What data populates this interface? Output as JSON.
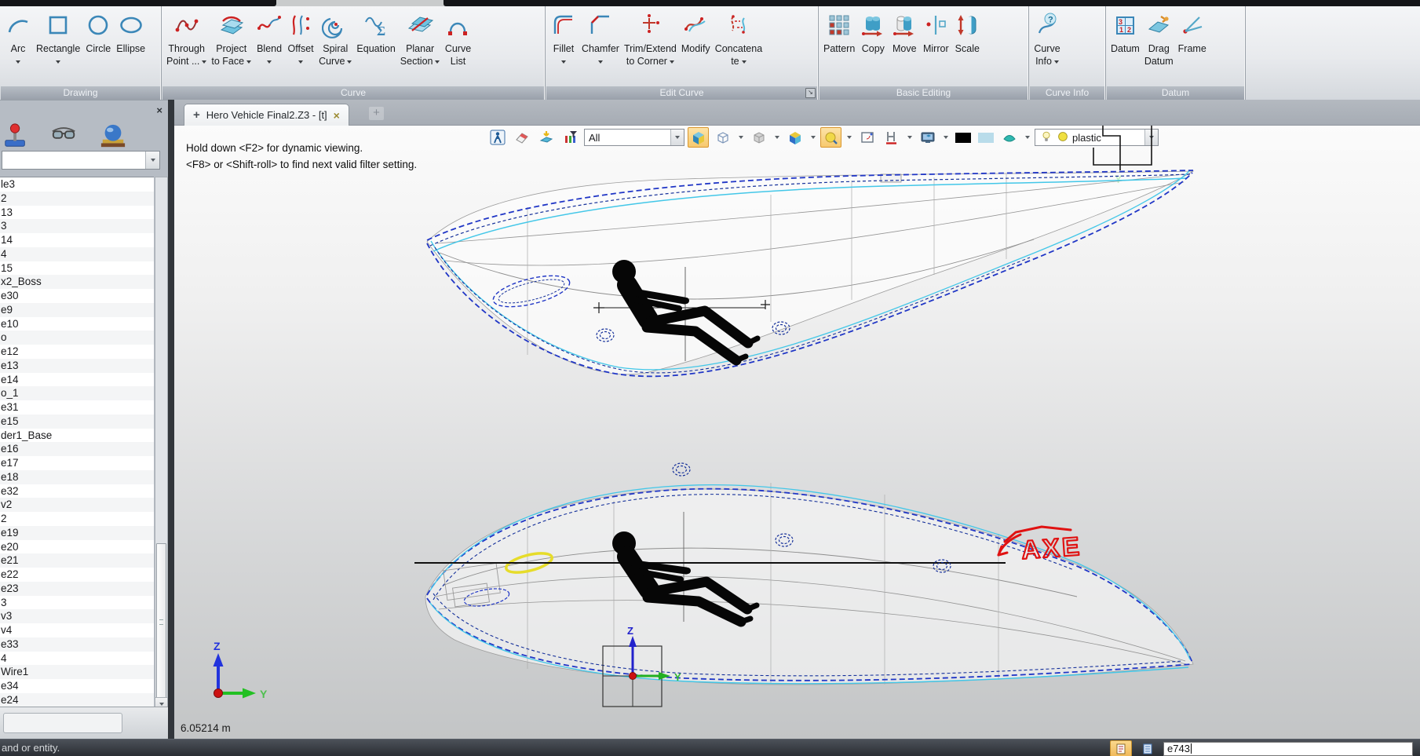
{
  "ribbon": {
    "groups": [
      {
        "label": "Drawing",
        "buttons": [
          {
            "icon": "arc",
            "line1": "Arc",
            "arrow": "below"
          },
          {
            "icon": "rectangle",
            "line1": "Rectangle",
            "arrow": "below"
          },
          {
            "icon": "circle",
            "line1": "Circle",
            "arrow": "none"
          },
          {
            "icon": "ellipse",
            "line1": "Ellipse",
            "arrow": "none"
          }
        ]
      },
      {
        "label": "Curve",
        "buttons": [
          {
            "icon": "through-point",
            "line1": "Through",
            "line2": "Point ...",
            "arrow": "inline"
          },
          {
            "icon": "project-to-face",
            "line1": "Project",
            "line2": "to Face",
            "arrow": "inline"
          },
          {
            "icon": "blend",
            "line1": "Blend",
            "arrow": "below"
          },
          {
            "icon": "offset",
            "line1": "Offset",
            "arrow": "below"
          },
          {
            "icon": "spiral-curve",
            "line1": "Spiral",
            "line2": "Curve",
            "arrow": "inline"
          },
          {
            "icon": "equation",
            "line1": "Equation",
            "arrow": "none"
          },
          {
            "icon": "planar-section",
            "line1": "Planar",
            "line2": "Section",
            "arrow": "inline"
          },
          {
            "icon": "curve-list",
            "line1": "Curve",
            "line2": "List",
            "arrow": "none"
          }
        ]
      },
      {
        "label": "Edit Curve",
        "dialog_launcher": true,
        "buttons": [
          {
            "icon": "fillet",
            "line1": "Fillet",
            "arrow": "below"
          },
          {
            "icon": "chamfer",
            "line1": "Chamfer",
            "arrow": "below"
          },
          {
            "icon": "trim-extend",
            "line1": "Trim/Extend",
            "line2": "to Corner",
            "arrow": "inline"
          },
          {
            "icon": "modify",
            "line1": "Modify",
            "arrow": "none"
          },
          {
            "icon": "concatenate",
            "line1": "Concatena",
            "line2": "te",
            "arrow": "inline"
          }
        ]
      },
      {
        "label": "Basic Editing",
        "buttons": [
          {
            "icon": "pattern",
            "line1": "Pattern",
            "arrow": "none"
          },
          {
            "icon": "copy",
            "line1": "Copy",
            "arrow": "none"
          },
          {
            "icon": "move",
            "line1": "Move",
            "arrow": "none"
          },
          {
            "icon": "mirror",
            "line1": "Mirror",
            "arrow": "none"
          },
          {
            "icon": "scale",
            "line1": "Scale",
            "arrow": "none"
          }
        ]
      },
      {
        "label": "Curve Info",
        "buttons": [
          {
            "icon": "curve-info",
            "line1": "Curve",
            "line2": "Info",
            "arrow": "inline"
          }
        ]
      },
      {
        "label": "Datum",
        "buttons": [
          {
            "icon": "datum",
            "line1": "Datum",
            "arrow": "none"
          },
          {
            "icon": "drag-datum",
            "line1": "Drag",
            "line2": "Datum",
            "arrow": "none"
          },
          {
            "icon": "frame",
            "line1": "Frame",
            "arrow": "none"
          }
        ]
      }
    ]
  },
  "sidebar": {
    "close_glyph": "×",
    "icons": [
      "manipulator-icon",
      "glasses-icon",
      "render-sphere-icon"
    ],
    "filter_value": "",
    "items": [
      "le3",
      "2",
      "13",
      "3",
      "14",
      "4",
      "15",
      "x2_Boss",
      "e30",
      "e9",
      "e10",
      "o",
      "e12",
      "e13",
      "e14",
      "o_1",
      "e31",
      "e15",
      "der1_Base",
      "e16",
      "e17",
      "e18",
      "e32",
      "v2",
      "2",
      "e19",
      "e20",
      "e21",
      "e22",
      "e23",
      "3",
      "v3",
      "v4",
      "e33",
      "4",
      "Wire1",
      "e34",
      "e24"
    ]
  },
  "tabbar": {
    "plus_glyph": "+",
    "active_tab": "Hero Vehicle Final2.Z3 - [t]",
    "close_glyph": "×",
    "new_tab_glyph": "+"
  },
  "viewport": {
    "hint_line1": "Hold down <F2> for dynamic viewing.",
    "hint_line2": "<F8> or <Shift-roll> to find next valid filter setting.",
    "scale_label": "6.05214 m",
    "annotation": "AXE",
    "axis_z": "Z",
    "axis_y": "Y",
    "toolbar": [
      {
        "name": "dynamic-pick-button",
        "type": "button",
        "icon": "walk-person"
      },
      {
        "name": "eraser-button",
        "type": "button",
        "icon": "eraser"
      },
      {
        "name": "face-pick-button",
        "type": "button",
        "icon": "face-target"
      },
      {
        "name": "filter-button",
        "type": "button",
        "icon": "filter"
      },
      {
        "name": "entity-filter-combo",
        "type": "combo",
        "value": "All",
        "width": 128
      },
      {
        "name": "shaded-display-button",
        "type": "button",
        "icon": "shaded-view",
        "active": true
      },
      {
        "name": "wireframe-display-button",
        "type": "button",
        "icon": "wireframe-view",
        "arrow": true
      },
      {
        "name": "hidden-line-display-button",
        "type": "button",
        "icon": "hidden-view",
        "arrow": true
      },
      {
        "name": "solid-display-button",
        "type": "button",
        "icon": "solid-view",
        "arrow": true
      },
      {
        "name": "zoom-face-button",
        "type": "button",
        "icon": "zoom-face",
        "active": true,
        "arrow": true
      },
      {
        "name": "viewport-window-button",
        "type": "button",
        "icon": "window-layout"
      },
      {
        "name": "section-view-button",
        "type": "button",
        "icon": "section-h",
        "arrow": true
      },
      {
        "name": "display-settings-button",
        "type": "button",
        "icon": "monitor-cube",
        "arrow": true
      },
      {
        "name": "edge-color-swatch",
        "type": "swatch",
        "icon": "swatch-black"
      },
      {
        "name": "face-color-swatch",
        "type": "swatch",
        "icon": "swatch-blue"
      },
      {
        "name": "surface-material-button",
        "type": "button",
        "icon": "surface-material",
        "arrow": true
      },
      {
        "name": "material-combo",
        "type": "combo",
        "value": "plastic",
        "width": 158,
        "icons": [
          "bulb",
          "sphere-yellow"
        ]
      }
    ],
    "colors": {
      "accent_active": "#f0b95a",
      "curve_blue": "#2036c6",
      "curve_navy": "#15309a",
      "curve_cyan": "#43c7e8",
      "annotation_red": "#e01212",
      "axis_z_blue": "#2233dd",
      "axis_y_green": "#22c022",
      "highlight_yellow": "#e6dc2a"
    }
  },
  "statusbar": {
    "message": "and or entity.",
    "input_value": "e743"
  }
}
